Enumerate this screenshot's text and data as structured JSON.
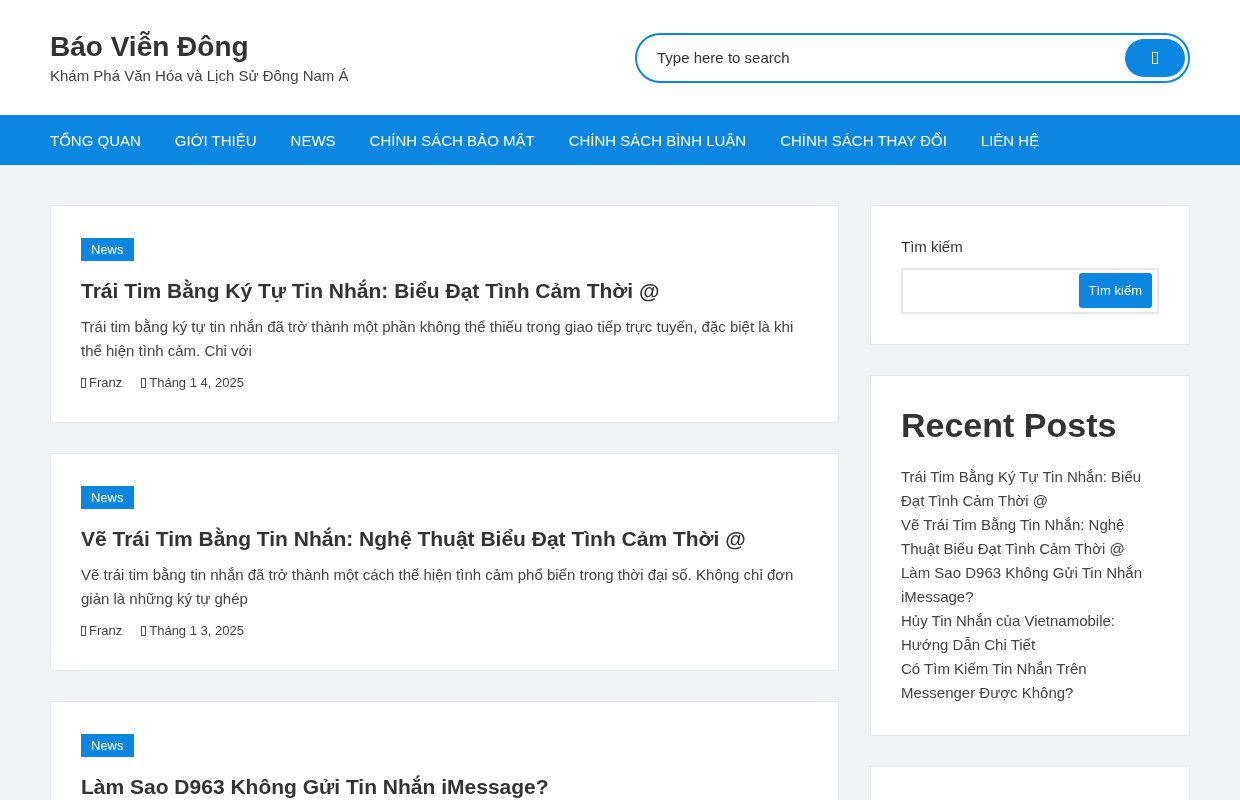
{
  "site": {
    "title": "Báo Viễn Đông",
    "tagline": "Khám Phá Văn Hóa và Lịch Sử Đông Nam Á"
  },
  "search": {
    "placeholder": "Type here to search"
  },
  "nav": [
    "TỔNG QUAN",
    "GIỚI THIỆU",
    "NEWS",
    "CHÍNH SÁCH BẢO MẬT",
    "CHÍNH SÁCH BÌNH LUẬN",
    "CHÍNH SÁCH THAY ĐỔI",
    "LIÊN HỆ"
  ],
  "posts": [
    {
      "category": "News",
      "title": "Trái Tim Bằng Ký Tự Tin Nhắn: Biểu Đạt Tình Cảm Thời @",
      "excerpt": "Trái tim bằng ký tự tin nhắn đã trở thành một phần không thể thiếu trong giao tiếp trực tuyến, đặc biệt là khi thể hiện tình cảm. Chỉ với",
      "author": "Franz",
      "date": "Tháng 1 4, 2025"
    },
    {
      "category": "News",
      "title": "Vẽ Trái Tim Bằng Tin Nhắn: Nghệ Thuật Biểu Đạt Tình Cảm Thời @",
      "excerpt": "Vẽ trái tim bằng tin nhắn đã trở thành một cách thể hiện tình cảm phổ biến trong thời đại số. Không chỉ đơn giản là những ký tự ghép",
      "author": "Franz",
      "date": "Tháng 1 3, 2025"
    },
    {
      "category": "News",
      "title": "Làm Sao D963 Không Gửi Tin Nhắn iMessage?"
    }
  ],
  "sidebar": {
    "search_label": "Tìm kiếm",
    "search_button": "Tìm kiếm",
    "recent_title": "Recent Posts",
    "recent": [
      "Trái Tim Bằng Ký Tự Tin Nhắn: Biểu Đạt Tình Cảm Thời @",
      "Vẽ Trái Tim Bằng Tin Nhắn: Nghệ Thuật Biểu Đạt Tình Cảm Thời @",
      "Làm Sao D963 Không Gửi Tin Nhắn iMessage?",
      "Hủy Tin Nhắn của Vietnamobile: Hướng Dẫn Chi Tiết",
      "Có Tìm Kiếm Tin Nhắn Trên Messenger Được Không?"
    ]
  }
}
